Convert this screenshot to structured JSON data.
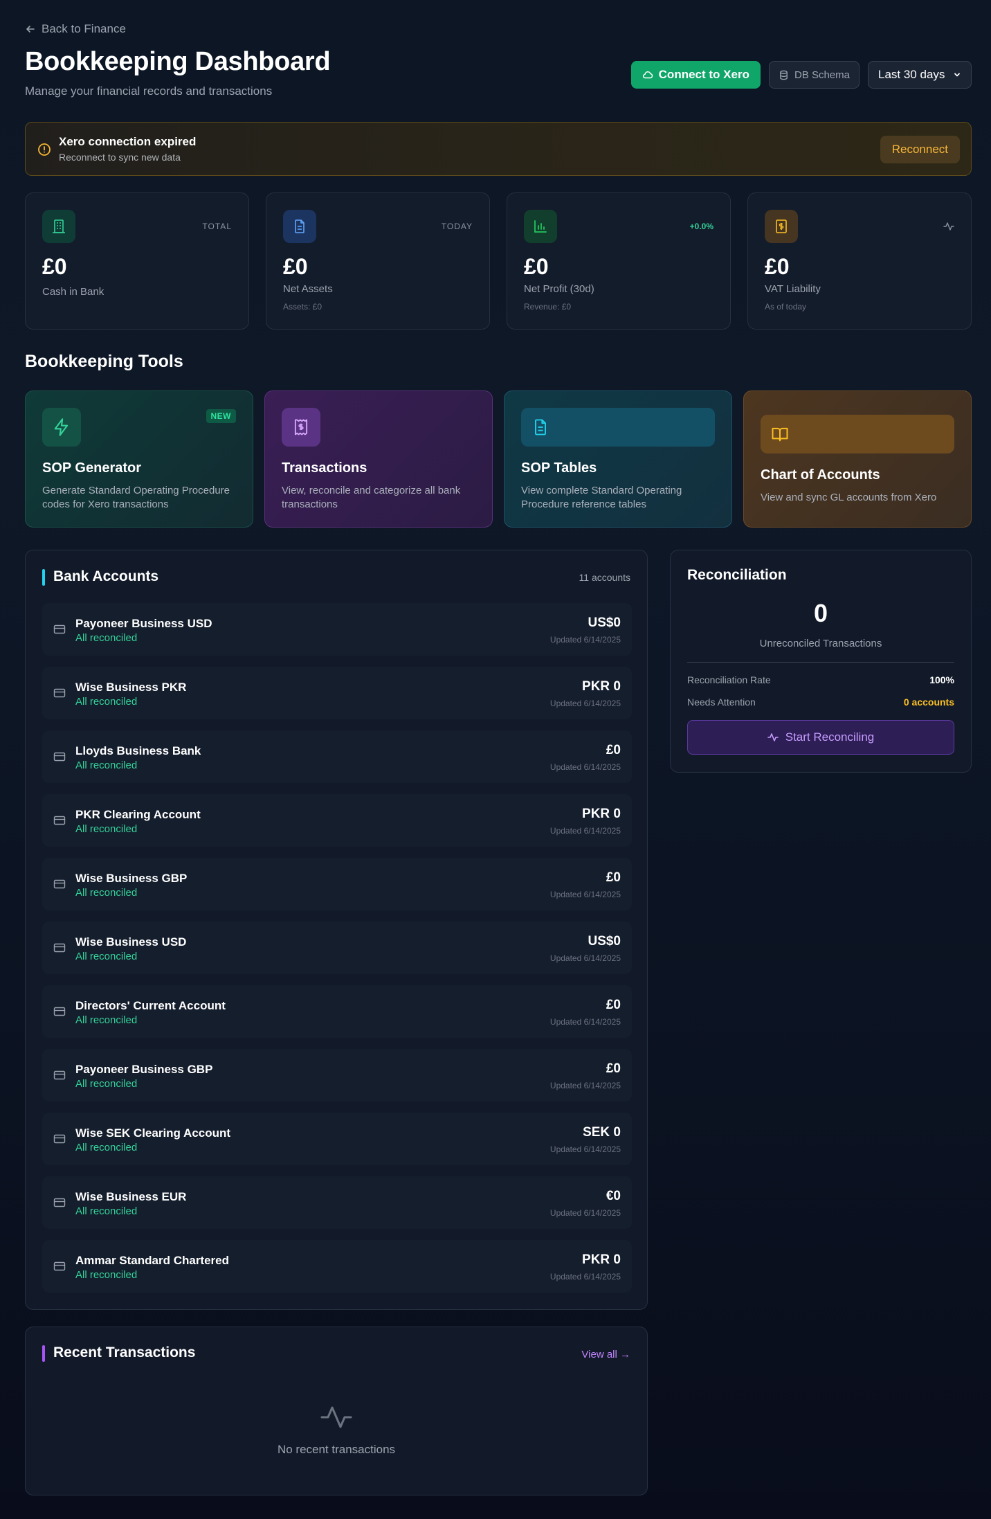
{
  "header": {
    "back_label": "Back to Finance",
    "title": "Bookkeeping Dashboard",
    "subtitle": "Manage your financial records and transactions",
    "connect_label": "Connect to Xero",
    "schema_label": "DB Schema",
    "range_selected": "Last 30 days"
  },
  "alert": {
    "title": "Xero connection expired",
    "subtitle": "Reconnect to sync new data",
    "action_label": "Reconnect"
  },
  "stats": [
    {
      "value": "£0",
      "label": "Cash in Bank",
      "tag": "TOTAL",
      "sub": ""
    },
    {
      "value": "£0",
      "label": "Net Assets",
      "tag": "TODAY",
      "sub": "Assets: £0"
    },
    {
      "value": "£0",
      "label": "Net Profit (30d)",
      "tag": "+0.0%",
      "sub": "Revenue: £0"
    },
    {
      "value": "£0",
      "label": "VAT Liability",
      "tag": "",
      "sub": "As of today"
    }
  ],
  "tools_section": {
    "title": "Bookkeeping Tools",
    "tools": [
      {
        "name": "SOP Generator",
        "badge": "NEW",
        "description": "Generate Standard Operating Procedure codes for Xero transactions"
      },
      {
        "name": "Transactions",
        "description": "View, reconcile and categorize all bank transactions"
      },
      {
        "name": "SOP Tables",
        "description": "View complete Standard Operating Procedure reference tables"
      },
      {
        "name": "Chart of Accounts",
        "description": "View and sync GL accounts from Xero"
      }
    ]
  },
  "bank_accounts": {
    "title": "Bank Accounts",
    "count_label": "11 accounts",
    "accounts": [
      {
        "name": "Payoneer Business USD",
        "status": "All reconciled",
        "amount": "US$0",
        "updated": "Updated 6/14/2025"
      },
      {
        "name": "Wise Business PKR",
        "status": "All reconciled",
        "amount": "PKR 0",
        "updated": "Updated 6/14/2025"
      },
      {
        "name": "Lloyds Business Bank",
        "status": "All reconciled",
        "amount": "£0",
        "updated": "Updated 6/14/2025"
      },
      {
        "name": "PKR Clearing Account",
        "status": "All reconciled",
        "amount": "PKR 0",
        "updated": "Updated 6/14/2025"
      },
      {
        "name": "Wise Business GBP",
        "status": "All reconciled",
        "amount": "£0",
        "updated": "Updated 6/14/2025"
      },
      {
        "name": "Wise Business USD",
        "status": "All reconciled",
        "amount": "US$0",
        "updated": "Updated 6/14/2025"
      },
      {
        "name": "Directors' Current Account",
        "status": "All reconciled",
        "amount": "£0",
        "updated": "Updated 6/14/2025"
      },
      {
        "name": "Payoneer Business GBP",
        "status": "All reconciled",
        "amount": "£0",
        "updated": "Updated 6/14/2025"
      },
      {
        "name": "Wise SEK Clearing Account",
        "status": "All reconciled",
        "amount": "SEK 0",
        "updated": "Updated 6/14/2025"
      },
      {
        "name": "Wise Business EUR",
        "status": "All reconciled",
        "amount": "€0",
        "updated": "Updated 6/14/2025"
      },
      {
        "name": "Ammar Standard Chartered",
        "status": "All reconciled",
        "amount": "PKR 0",
        "updated": "Updated 6/14/2025"
      }
    ]
  },
  "reconciliation": {
    "title": "Reconciliation",
    "unreconciled_count": "0",
    "unreconciled_label": "Unreconciled Transactions",
    "rate_label": "Reconciliation Rate",
    "rate_value": "100%",
    "attention_label": "Needs Attention",
    "attention_value": "0 accounts",
    "action_label": "Start Reconciling"
  },
  "recent_transactions": {
    "title": "Recent Transactions",
    "view_all_label": "View all →",
    "empty_label": "No recent transactions"
  },
  "colors": {
    "accent_green": "#10a66a",
    "reconciled_green": "#34d399",
    "warning_amber": "#fbbf24",
    "purple": "#c084fc",
    "cyan": "#22d3ee"
  }
}
